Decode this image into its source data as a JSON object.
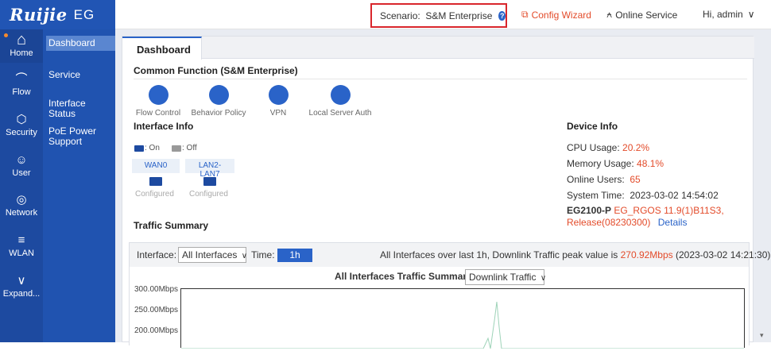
{
  "brand": {
    "logo": "Ruijie",
    "product": "EG"
  },
  "topbar": {
    "scenario_label": "Scenario:  S&M Enterprise",
    "help_icon": "?",
    "config_wizard": "Config Wizard",
    "config_wizard_icon": "⧉",
    "online_service": "Online Service",
    "online_service_icon": "⍲",
    "admin": "Hi, admin",
    "admin_icon": "∨"
  },
  "rail": [
    {
      "label": "Home",
      "icon": "⌂"
    },
    {
      "label": "Flow",
      "icon": "⌒"
    },
    {
      "label": "Security",
      "icon": "⬡"
    },
    {
      "label": "User",
      "icon": "☺"
    },
    {
      "label": "Network",
      "icon": "◎"
    },
    {
      "label": "WLAN",
      "icon": "≡"
    },
    {
      "label": "Expand...",
      "icon": "∨"
    }
  ],
  "subnav": [
    "Dashboard",
    "Service",
    "Interface Status",
    "PoE Power Support"
  ],
  "tab": "Dashboard",
  "common_function": {
    "title": "Common Function (S&M Enterprise)",
    "items": [
      "Flow Control",
      "Behavior Policy",
      "VPN",
      "Local Server Auth"
    ]
  },
  "interface_info": {
    "title": "Interface Info",
    "legend_on": ": On",
    "legend_off": ": Off",
    "ports": [
      {
        "name": "WAN0",
        "status": "Configured"
      },
      {
        "name": "LAN2-LAN7",
        "status": "Configured"
      }
    ]
  },
  "device_info": {
    "title": "Device Info",
    "cpu_label": "CPU Usage: ",
    "cpu_value": "20.2%",
    "mem_label": "Memory Usage: ",
    "mem_value": "48.1%",
    "users_label": "Online Users:  ",
    "users_value": "65",
    "time_label": "System Time:  2023-03-02 14:54:02",
    "model": "EG2100-P",
    "version": "EG_RGOS 11.9(1)B11S3,",
    "release": "Release(08230300)",
    "details": "Details"
  },
  "traffic": {
    "title": "Traffic Summary",
    "interface_label": "Interface:",
    "interface_value": "All Interfaces",
    "time_label": "Time:",
    "time_value": "1h",
    "peak_prefix": "All Interfaces over last 1h, Downlink Traffic peak value is ",
    "peak_value": "270.92Mbps",
    "peak_time": " (2023-03-02 14:21:30)",
    "chart_title": "All Interfaces Traffic Summary",
    "direction_value": "Downlink Traffic",
    "dropdown_icon": "∨",
    "yticks": [
      "300.00Mbps",
      "250.00Mbps",
      "200.00Mbps"
    ]
  }
}
